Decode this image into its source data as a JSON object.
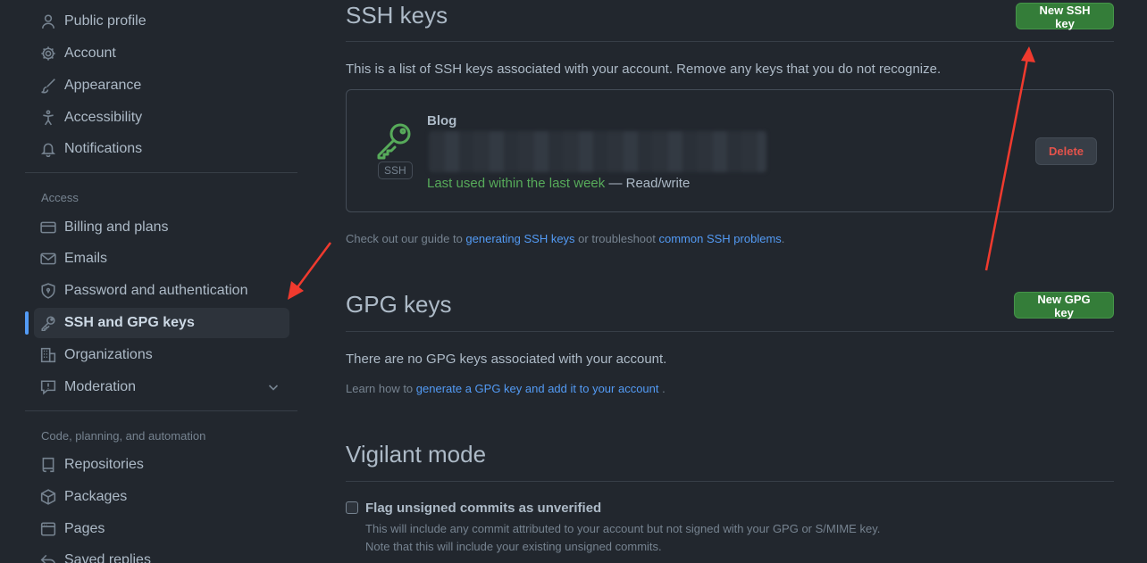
{
  "sidebar": {
    "items_top": [
      {
        "label": "Public profile",
        "icon": "person-icon"
      },
      {
        "label": "Account",
        "icon": "gear-icon"
      },
      {
        "label": "Appearance",
        "icon": "paintbrush-icon"
      },
      {
        "label": "Accessibility",
        "icon": "accessibility-icon"
      },
      {
        "label": "Notifications",
        "icon": "bell-icon"
      }
    ],
    "access_label": "Access",
    "items_access": [
      {
        "label": "Billing and plans",
        "icon": "credit-card-icon"
      },
      {
        "label": "Emails",
        "icon": "mail-icon"
      },
      {
        "label": "Password and authentication",
        "icon": "shield-lock-icon"
      },
      {
        "label": "SSH and GPG keys",
        "icon": "key-icon"
      },
      {
        "label": "Organizations",
        "icon": "organization-icon"
      },
      {
        "label": "Moderation",
        "icon": "report-icon"
      }
    ],
    "code_label": "Code, planning, and automation",
    "items_code": [
      {
        "label": "Repositories",
        "icon": "repo-icon"
      },
      {
        "label": "Packages",
        "icon": "package-icon"
      },
      {
        "label": "Pages",
        "icon": "browser-icon"
      },
      {
        "label": "Saved replies",
        "icon": "reply-icon"
      }
    ]
  },
  "ssh": {
    "title": "SSH keys",
    "new_button": "New SSH key",
    "description": "This is a list of SSH keys associated with your account. Remove any keys that you do not recognize.",
    "key": {
      "title": "Blog",
      "tag": "SSH",
      "last_used": "Last used within the last week",
      "access": " — Read/write",
      "delete_label": "Delete"
    },
    "guide_prefix": "Check out our guide to ",
    "guide_link1": "generating SSH keys",
    "guide_middle": " or troubleshoot ",
    "guide_link2": "common SSH problems",
    "guide_suffix": "."
  },
  "gpg": {
    "title": "GPG keys",
    "new_button": "New GPG key",
    "empty_text": "There are no GPG keys associated with your account.",
    "learn_prefix": "Learn how to ",
    "learn_link": "generate a GPG key and add it to your account",
    "learn_suffix": " ."
  },
  "vigilant": {
    "title": "Vigilant mode",
    "checkbox_label": "Flag unsigned commits as unverified",
    "note1": "This will include any commit attributed to your account but not signed with your GPG or S/MIME key.",
    "note2": "Note that this will include your existing unsigned commits."
  },
  "colors": {
    "background": "#22272e",
    "accent": "#539bf5",
    "primary_button": "#347d39",
    "danger": "#e5534b",
    "annotation_arrow": "#f03a2e"
  }
}
